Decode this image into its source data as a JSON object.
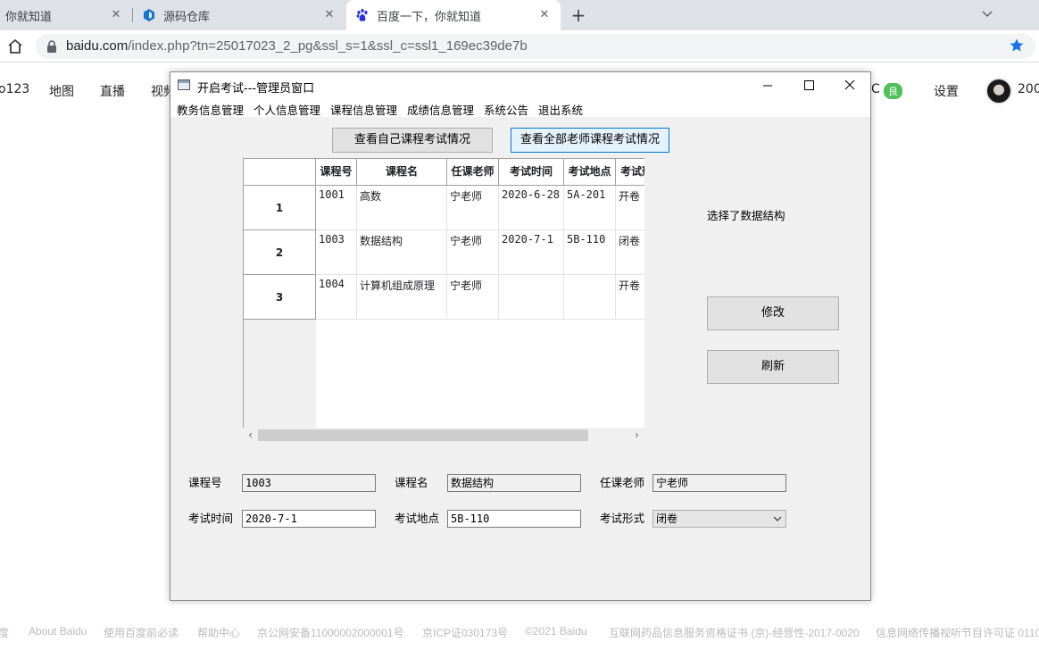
{
  "browser": {
    "tabs": [
      {
        "title": "你就知道",
        "active": false
      },
      {
        "title": "源码仓库",
        "active": false
      },
      {
        "title": "百度一下，你就知道",
        "active": true
      }
    ],
    "url_host": "baidu.com",
    "url_rest": "/index.php?tn=25017023_2_pg&ssl_s=1&ssl_c=ssl1_169ec39de7b"
  },
  "baidu": {
    "nav": [
      "o123",
      "地图",
      "直播",
      "视频",
      "C",
      "设置",
      "200"
    ],
    "badge": "良",
    "footer": [
      "度",
      "About Baidu",
      "使用百度前必读",
      "帮助中心",
      "京公网安备11000002000001号",
      "京ICP证030173号",
      "©2021 Baidu",
      "互联网药品信息服务资格证书 (京)-经营性-2017-0020",
      "信息网络传播视听节目许可证 0110"
    ]
  },
  "window": {
    "title": "开启考试---管理员窗口",
    "menu": [
      "教务信息管理",
      "个人信息管理",
      "课程信息管理",
      "成绩信息管理",
      "系统公告",
      "退出系统"
    ],
    "btn_own": "查看自己课程考试情况",
    "btn_all": "查看全部老师课程考试情况",
    "status": "选择了数据结构",
    "btn_modify": "修改",
    "btn_refresh": "刷新"
  },
  "table": {
    "columns": [
      "课程号",
      "课程名",
      "任课老师",
      "考试时间",
      "考试地点",
      "考试形式"
    ],
    "row_headers": [
      "1",
      "2",
      "3"
    ],
    "rows": [
      [
        "1001",
        "高数",
        "宁老师",
        "2020-6-28",
        "5A-201",
        "开卷"
      ],
      [
        "1003",
        "数据结构",
        "宁老师",
        "2020-7-1",
        "5B-110",
        "闭卷"
      ],
      [
        "1004",
        "计算机组成原理",
        "宁老师",
        "",
        "",
        "开卷"
      ]
    ]
  },
  "form": {
    "course_id_label": "课程号",
    "course_id": "1003",
    "course_name_label": "课程名",
    "course_name": "数据结构",
    "teacher_label": "任课老师",
    "teacher": "宁老师",
    "time_label": "考试时间",
    "time": "2020-7-1",
    "place_label": "考试地点",
    "place": "5B-110",
    "form_label": "考试形式",
    "exam_form": "闭卷"
  }
}
